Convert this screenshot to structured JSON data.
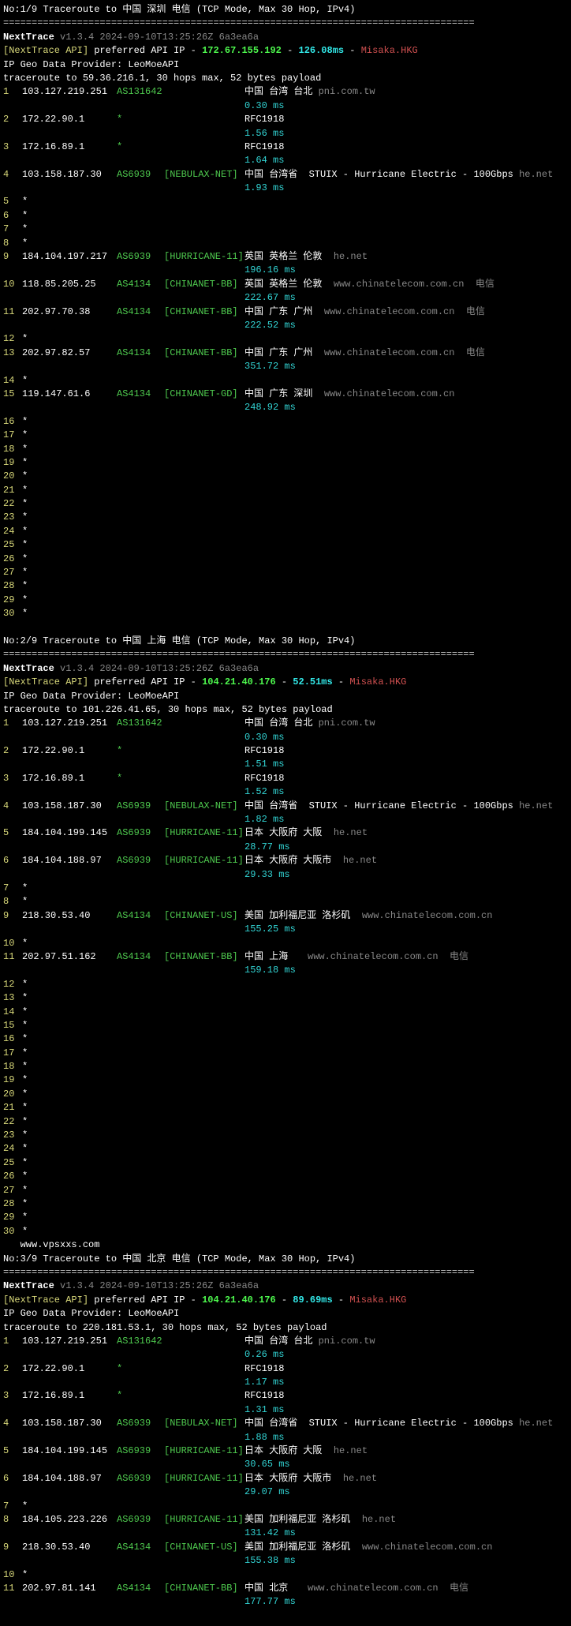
{
  "app": "NextTrace",
  "version": "v1.3.4 2024-09-10T13:25:26Z 6a3ea6a",
  "geo_provider": "IP Geo Data Provider: LeoMoeAPI",
  "watermark": "www.vpsxxs.com",
  "sep_line": "===================================================================================",
  "apiserver_label": "[NextTrace API]",
  "preferred_label": "preferred API IP - ",
  "misaka_label": "Misaka.HKG",
  "runs": [
    {
      "title": "No:1/9 Traceroute to 中国 深圳 电信 (TCP Mode, Max 30 Hop, IPv4)",
      "api_ip": "172.67.155.192",
      "api_ms": "126.08ms",
      "route_line": "traceroute to 59.36.216.1, 30 hops max, 52 bytes payload",
      "hops": [
        {
          "n": "1",
          "ip": "103.127.219.251",
          "as": "AS131642",
          "net": "",
          "geo": "中国 台湾 台北 ",
          "host": "pni.com.tw",
          "lat": "0.30 ms"
        },
        {
          "n": "2",
          "ip": "172.22.90.1",
          "as": "*",
          "net": "",
          "geo": "RFC1918",
          "host": "",
          "lat": "1.56 ms"
        },
        {
          "n": "3",
          "ip": "172.16.89.1",
          "as": "*",
          "net": "",
          "geo": "RFC1918",
          "host": "",
          "lat": "1.64 ms"
        },
        {
          "n": "4",
          "ip": "103.158.187.30",
          "as": "AS6939",
          "net": "[NEBULAX-NET]",
          "geo": "中国 台湾省  STUIX - Hurricane Electric - 100Gbps ",
          "host": "he.net",
          "lat": "1.93 ms"
        },
        {
          "n": "5",
          "ip": "*",
          "as": "",
          "net": "",
          "geo": "",
          "host": "",
          "lat": ""
        },
        {
          "n": "6",
          "ip": "*",
          "as": "",
          "net": "",
          "geo": "",
          "host": "",
          "lat": ""
        },
        {
          "n": "7",
          "ip": "*",
          "as": "",
          "net": "",
          "geo": "",
          "host": "",
          "lat": ""
        },
        {
          "n": "8",
          "ip": "*",
          "as": "",
          "net": "",
          "geo": "",
          "host": "",
          "lat": ""
        },
        {
          "n": "9",
          "ip": "184.104.197.217",
          "as": "AS6939",
          "net": "[HURRICANE-11]",
          "geo": "英国 英格兰 伦敦  ",
          "host": "he.net",
          "lat": "196.16 ms"
        },
        {
          "n": "10",
          "ip": "118.85.205.25",
          "as": "AS4134",
          "net": "[CHINANET-BB]",
          "geo": "英国 英格兰 伦敦  ",
          "host": "www.chinatelecom.com.cn  电信",
          "lat": "222.67 ms"
        },
        {
          "n": "11",
          "ip": "202.97.70.38",
          "as": "AS4134",
          "net": "[CHINANET-BB]",
          "geo": "中国 广东 广州  ",
          "host": "www.chinatelecom.com.cn  电信",
          "lat": "222.52 ms"
        },
        {
          "n": "12",
          "ip": "*",
          "as": "",
          "net": "",
          "geo": "",
          "host": "",
          "lat": ""
        },
        {
          "n": "13",
          "ip": "202.97.82.57",
          "as": "AS4134",
          "net": "[CHINANET-BB]",
          "geo": "中国 广东 广州  ",
          "host": "www.chinatelecom.com.cn  电信",
          "lat": "351.72 ms"
        },
        {
          "n": "14",
          "ip": "*",
          "as": "",
          "net": "",
          "geo": "",
          "host": "",
          "lat": ""
        },
        {
          "n": "15",
          "ip": "119.147.61.6",
          "as": "AS4134",
          "net": "[CHINANET-GD]",
          "geo": "中国 广东 深圳  ",
          "host": "www.chinatelecom.com.cn",
          "lat": "248.92 ms"
        },
        {
          "n": "16",
          "ip": "*",
          "as": "",
          "net": "",
          "geo": "",
          "host": "",
          "lat": ""
        },
        {
          "n": "17",
          "ip": "*",
          "as": "",
          "net": "",
          "geo": "",
          "host": "",
          "lat": ""
        },
        {
          "n": "18",
          "ip": "*",
          "as": "",
          "net": "",
          "geo": "",
          "host": "",
          "lat": ""
        },
        {
          "n": "19",
          "ip": "*",
          "as": "",
          "net": "",
          "geo": "",
          "host": "",
          "lat": ""
        },
        {
          "n": "20",
          "ip": "*",
          "as": "",
          "net": "",
          "geo": "",
          "host": "",
          "lat": ""
        },
        {
          "n": "21",
          "ip": "*",
          "as": "",
          "net": "",
          "geo": "",
          "host": "",
          "lat": ""
        },
        {
          "n": "22",
          "ip": "*",
          "as": "",
          "net": "",
          "geo": "",
          "host": "",
          "lat": ""
        },
        {
          "n": "23",
          "ip": "*",
          "as": "",
          "net": "",
          "geo": "",
          "host": "",
          "lat": ""
        },
        {
          "n": "24",
          "ip": "*",
          "as": "",
          "net": "",
          "geo": "",
          "host": "",
          "lat": ""
        },
        {
          "n": "25",
          "ip": "*",
          "as": "",
          "net": "",
          "geo": "",
          "host": "",
          "lat": ""
        },
        {
          "n": "26",
          "ip": "*",
          "as": "",
          "net": "",
          "geo": "",
          "host": "",
          "lat": ""
        },
        {
          "n": "27",
          "ip": "*",
          "as": "",
          "net": "",
          "geo": "",
          "host": "",
          "lat": ""
        },
        {
          "n": "28",
          "ip": "*",
          "as": "",
          "net": "",
          "geo": "",
          "host": "",
          "lat": ""
        },
        {
          "n": "29",
          "ip": "*",
          "as": "",
          "net": "",
          "geo": "",
          "host": "",
          "lat": ""
        },
        {
          "n": "30",
          "ip": "*",
          "as": "",
          "net": "",
          "geo": "",
          "host": "",
          "lat": ""
        }
      ]
    },
    {
      "title": "No:2/9 Traceroute to 中国 上海 电信 (TCP Mode, Max 30 Hop, IPv4)",
      "api_ip": "104.21.40.176",
      "api_ms": "52.51ms",
      "route_line": "traceroute to 101.226.41.65, 30 hops max, 52 bytes payload",
      "hops": [
        {
          "n": "1",
          "ip": "103.127.219.251",
          "as": "AS131642",
          "net": "",
          "geo": "中国 台湾 台北 ",
          "host": "pni.com.tw",
          "lat": "0.30 ms"
        },
        {
          "n": "2",
          "ip": "172.22.90.1",
          "as": "*",
          "net": "",
          "geo": "RFC1918",
          "host": "",
          "lat": "1.51 ms"
        },
        {
          "n": "3",
          "ip": "172.16.89.1",
          "as": "*",
          "net": "",
          "geo": "RFC1918",
          "host": "",
          "lat": "1.52 ms"
        },
        {
          "n": "4",
          "ip": "103.158.187.30",
          "as": "AS6939",
          "net": "[NEBULAX-NET]",
          "geo": "中国 台湾省  STUIX - Hurricane Electric - 100Gbps ",
          "host": "he.net",
          "lat": "1.82 ms"
        },
        {
          "n": "5",
          "ip": "184.104.199.145",
          "as": "AS6939",
          "net": "[HURRICANE-11]",
          "geo": "日本 大阪府 大阪  ",
          "host": "he.net",
          "lat": "28.77 ms"
        },
        {
          "n": "6",
          "ip": "184.104.188.97",
          "as": "AS6939",
          "net": "[HURRICANE-11]",
          "geo": "日本 大阪府 大阪市  ",
          "host": "he.net",
          "lat": "29.33 ms"
        },
        {
          "n": "7",
          "ip": "*",
          "as": "",
          "net": "",
          "geo": "",
          "host": "",
          "lat": ""
        },
        {
          "n": "8",
          "ip": "*",
          "as": "",
          "net": "",
          "geo": "",
          "host": "",
          "lat": ""
        },
        {
          "n": "9",
          "ip": "218.30.53.40",
          "as": "AS4134",
          "net": "[CHINANET-US]",
          "geo": "美国 加利福尼亚 洛杉矶  ",
          "host": "www.chinatelecom.com.cn",
          "lat": "155.25 ms"
        },
        {
          "n": "10",
          "ip": "*",
          "as": "",
          "net": "",
          "geo": "",
          "host": "",
          "lat": ""
        },
        {
          "n": "11",
          "ip": "202.97.51.162",
          "as": "AS4134",
          "net": "[CHINANET-BB]",
          "geo": "中国 上海   ",
          "host": "www.chinatelecom.com.cn  电信",
          "lat": "159.18 ms"
        },
        {
          "n": "12",
          "ip": "*",
          "as": "",
          "net": "",
          "geo": "",
          "host": "",
          "lat": ""
        },
        {
          "n": "13",
          "ip": "*",
          "as": "",
          "net": "",
          "geo": "",
          "host": "",
          "lat": ""
        },
        {
          "n": "14",
          "ip": "*",
          "as": "",
          "net": "",
          "geo": "",
          "host": "",
          "lat": ""
        },
        {
          "n": "15",
          "ip": "*",
          "as": "",
          "net": "",
          "geo": "",
          "host": "",
          "lat": ""
        },
        {
          "n": "16",
          "ip": "*",
          "as": "",
          "net": "",
          "geo": "",
          "host": "",
          "lat": ""
        },
        {
          "n": "17",
          "ip": "*",
          "as": "",
          "net": "",
          "geo": "",
          "host": "",
          "lat": ""
        },
        {
          "n": "18",
          "ip": "*",
          "as": "",
          "net": "",
          "geo": "",
          "host": "",
          "lat": ""
        },
        {
          "n": "19",
          "ip": "*",
          "as": "",
          "net": "",
          "geo": "",
          "host": "",
          "lat": ""
        },
        {
          "n": "20",
          "ip": "*",
          "as": "",
          "net": "",
          "geo": "",
          "host": "",
          "lat": ""
        },
        {
          "n": "21",
          "ip": "*",
          "as": "",
          "net": "",
          "geo": "",
          "host": "",
          "lat": ""
        },
        {
          "n": "22",
          "ip": "*",
          "as": "",
          "net": "",
          "geo": "",
          "host": "",
          "lat": ""
        },
        {
          "n": "23",
          "ip": "*",
          "as": "",
          "net": "",
          "geo": "",
          "host": "",
          "lat": ""
        },
        {
          "n": "24",
          "ip": "*",
          "as": "",
          "net": "",
          "geo": "",
          "host": "",
          "lat": ""
        },
        {
          "n": "25",
          "ip": "*",
          "as": "",
          "net": "",
          "geo": "",
          "host": "",
          "lat": ""
        },
        {
          "n": "26",
          "ip": "*",
          "as": "",
          "net": "",
          "geo": "",
          "host": "",
          "lat": ""
        },
        {
          "n": "27",
          "ip": "*",
          "as": "",
          "net": "",
          "geo": "",
          "host": "",
          "lat": ""
        },
        {
          "n": "28",
          "ip": "*",
          "as": "",
          "net": "",
          "geo": "",
          "host": "",
          "lat": ""
        },
        {
          "n": "29",
          "ip": "*",
          "as": "",
          "net": "",
          "geo": "",
          "host": "",
          "lat": ""
        },
        {
          "n": "30",
          "ip": "*",
          "as": "",
          "net": "",
          "geo": "",
          "host": "",
          "lat": ""
        }
      ]
    },
    {
      "title": "No:3/9 Traceroute to 中国 北京 电信 (TCP Mode, Max 30 Hop, IPv4)",
      "api_ip": "104.21.40.176",
      "api_ms": "89.69ms",
      "route_line": "traceroute to 220.181.53.1, 30 hops max, 52 bytes payload",
      "hops": [
        {
          "n": "1",
          "ip": "103.127.219.251",
          "as": "AS131642",
          "net": "",
          "geo": "中国 台湾 台北 ",
          "host": "pni.com.tw",
          "lat": "0.26 ms"
        },
        {
          "n": "2",
          "ip": "172.22.90.1",
          "as": "*",
          "net": "",
          "geo": "RFC1918",
          "host": "",
          "lat": "1.17 ms"
        },
        {
          "n": "3",
          "ip": "172.16.89.1",
          "as": "*",
          "net": "",
          "geo": "RFC1918",
          "host": "",
          "lat": "1.31 ms"
        },
        {
          "n": "4",
          "ip": "103.158.187.30",
          "as": "AS6939",
          "net": "[NEBULAX-NET]",
          "geo": "中国 台湾省  STUIX - Hurricane Electric - 100Gbps ",
          "host": "he.net",
          "lat": "1.88 ms"
        },
        {
          "n": "5",
          "ip": "184.104.199.145",
          "as": "AS6939",
          "net": "[HURRICANE-11]",
          "geo": "日本 大阪府 大阪  ",
          "host": "he.net",
          "lat": "30.65 ms"
        },
        {
          "n": "6",
          "ip": "184.104.188.97",
          "as": "AS6939",
          "net": "[HURRICANE-11]",
          "geo": "日本 大阪府 大阪市  ",
          "host": "he.net",
          "lat": "29.07 ms"
        },
        {
          "n": "7",
          "ip": "*",
          "as": "",
          "net": "",
          "geo": "",
          "host": "",
          "lat": ""
        },
        {
          "n": "8",
          "ip": "184.105.223.226",
          "as": "AS6939",
          "net": "[HURRICANE-11]",
          "geo": "美国 加利福尼亚 洛杉矶  ",
          "host": "he.net",
          "lat": "131.42 ms"
        },
        {
          "n": "9",
          "ip": "218.30.53.40",
          "as": "AS4134",
          "net": "[CHINANET-US]",
          "geo": "美国 加利福尼亚 洛杉矶  ",
          "host": "www.chinatelecom.com.cn",
          "lat": "155.38 ms"
        },
        {
          "n": "10",
          "ip": "*",
          "as": "",
          "net": "",
          "geo": "",
          "host": "",
          "lat": ""
        },
        {
          "n": "11",
          "ip": "202.97.81.141",
          "as": "AS4134",
          "net": "[CHINANET-BB]",
          "geo": "中国 北京   ",
          "host": "www.chinatelecom.com.cn  电信",
          "lat": "177.77 ms"
        }
      ]
    }
  ]
}
